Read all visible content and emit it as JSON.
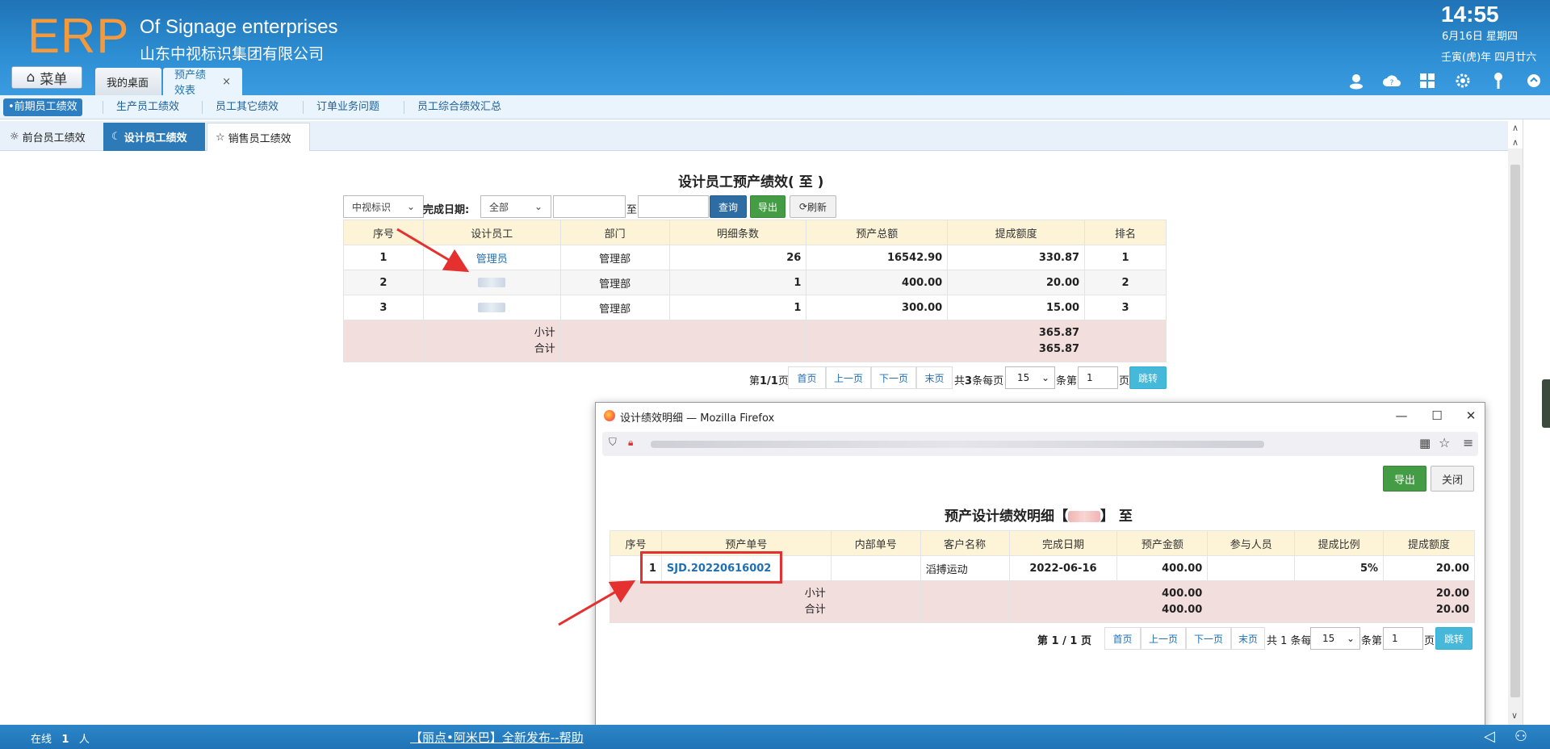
{
  "header": {
    "logo": "ERP",
    "brand_en": "Of Signage enterprises",
    "brand_cn": "山东中视标识集团有限公司",
    "time": "14:55",
    "date": "6月16日 星期四",
    "lunar": "壬寅(虎)年 四月廿六",
    "menu_label": "菜单",
    "tabs": [
      {
        "label": "我的桌面"
      },
      {
        "label": "预产绩效表",
        "close": "×"
      }
    ],
    "icons": [
      "user-icon",
      "cloud-help-icon",
      "apps-icon",
      "settings-icon",
      "key-icon",
      "collapse-icon"
    ]
  },
  "subnav": {
    "items": [
      {
        "label": "•前期员工绩效"
      },
      {
        "label": "生产员工绩效"
      },
      {
        "label": "员工其它绩效"
      },
      {
        "label": "订单业务问题"
      },
      {
        "label": "员工综合绩效汇总"
      }
    ]
  },
  "tabs2": {
    "items": [
      {
        "label": "前台员工绩效"
      },
      {
        "label": "设计员工绩效"
      },
      {
        "label": "销售员工绩效"
      }
    ]
  },
  "report": {
    "title": "设计员工预产绩效( 至 )",
    "company_select": "中视标识",
    "date_label": "完成日期:",
    "date_select": "全部",
    "to_label": "至",
    "btn_query": "查询",
    "btn_export": "导出",
    "btn_refresh": "刷新",
    "columns": [
      "序号",
      "设计员工",
      "部门",
      "明细条数",
      "预产总额",
      "提成额度",
      "排名"
    ],
    "rows": [
      {
        "no": "1",
        "name": "管理员",
        "dept": "管理部",
        "count": "26",
        "total": "16542.90",
        "commission": "330.87",
        "rank": "1"
      },
      {
        "no": "2",
        "name": "",
        "dept": "管理部",
        "count": "1",
        "total": "400.00",
        "commission": "20.00",
        "rank": "2"
      },
      {
        "no": "3",
        "name": "",
        "dept": "管理部",
        "count": "1",
        "total": "300.00",
        "commission": "15.00",
        "rank": "3"
      }
    ],
    "subtotal_label": "小计",
    "total_label": "合计",
    "subtotal": "365.87",
    "total": "365.87"
  },
  "pager": {
    "page_info_pre": "第",
    "page_info": "1/1",
    "page_info_post": "页",
    "first": "首页",
    "prev": "上一页",
    "next": "下一页",
    "last": "末页",
    "count_pre": "共",
    "count": "3",
    "count_post": "条每页",
    "per_page": "15",
    "jump_pre": "条第",
    "jump_page": "1",
    "jump_post": "页",
    "jump_btn": "跳转"
  },
  "popup": {
    "window_title": "设计绩效明细 — Mozilla Firefox",
    "btn_export": "导出",
    "btn_close": "关闭",
    "title_pre": "预产设计绩效明细【",
    "title_post": "】 至",
    "columns": [
      "序号",
      "预产单号",
      "内部单号",
      "客户名称",
      "完成日期",
      "预产金额",
      "参与人员",
      "提成比例",
      "提成额度"
    ],
    "rows": [
      {
        "no": "1",
        "order": "SJD.20220616002",
        "inner": "",
        "customer": "滔搏运动",
        "date": "2022-06-16",
        "amount": "400.00",
        "people": "",
        "ratio": "5%",
        "commission": "20.00"
      }
    ],
    "subtotal_label": "小计",
    "total_label": "合计",
    "subtotal_amount": "400.00",
    "total_amount": "400.00",
    "subtotal_commission": "20.00",
    "total_commission": "20.00",
    "pager": {
      "page_info": "第 1 / 1 页",
      "first": "首页",
      "prev": "上一页",
      "next": "下一页",
      "last": "末页",
      "count_text": "共 1 条每页",
      "per_page": "15",
      "jump_pre": "条第",
      "jump_page": "1",
      "jump_post": "页",
      "jump_btn": "跳转"
    }
  },
  "status": {
    "online_pre": "在线",
    "online_count": "1",
    "online_post": "人",
    "marquee": "【丽点•阿米巴】全新发布--帮助"
  },
  "colors": {
    "header_blue": "#1f73b6",
    "logo_orange": "#f49a3c",
    "table_header": "#fdf4d8",
    "summary_row": "#f3dede",
    "highlight_red": "#e53030"
  }
}
